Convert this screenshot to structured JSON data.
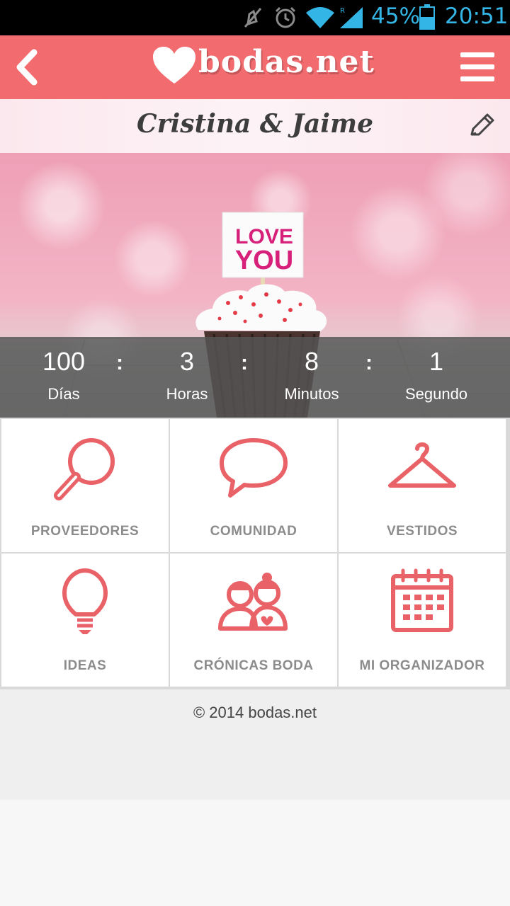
{
  "status_bar": {
    "battery_percent": "45%",
    "time": "20:51",
    "icons": [
      "mute-icon",
      "alarm-icon",
      "wifi-icon",
      "signal-icon",
      "battery-icon"
    ]
  },
  "header": {
    "brand": "bodas.net",
    "back_icon": "chevron-left-icon",
    "menu_icon": "hamburger-menu-icon",
    "color": "#f26b6e"
  },
  "couple": {
    "name": "Cristina & Jaime",
    "edit_icon": "pencil-icon"
  },
  "hero": {
    "sign_text_line1": "LOVE",
    "sign_text_line2": "YOU"
  },
  "countdown": {
    "days": {
      "value": "100",
      "label": "Días"
    },
    "hours": {
      "value": "3",
      "label": "Horas"
    },
    "minutes": {
      "value": "8",
      "label": "Minutos"
    },
    "seconds": {
      "value": "1",
      "label": "Segundo"
    },
    "separator": ":"
  },
  "menu_grid": [
    {
      "label": "PROVEEDORES",
      "icon": "magnifier-icon"
    },
    {
      "label": "COMUNIDAD",
      "icon": "speech-bubble-icon"
    },
    {
      "label": "VESTIDOS",
      "icon": "hanger-icon"
    },
    {
      "label": "IDEAS",
      "icon": "lightbulb-icon"
    },
    {
      "label": "CRÓNICAS BODA",
      "icon": "couple-icon"
    },
    {
      "label": "MI ORGANIZADOR",
      "icon": "calendar-icon"
    }
  ],
  "icon_color": "#e86268",
  "footer": {
    "copyright": "© 2014 bodas.net"
  }
}
